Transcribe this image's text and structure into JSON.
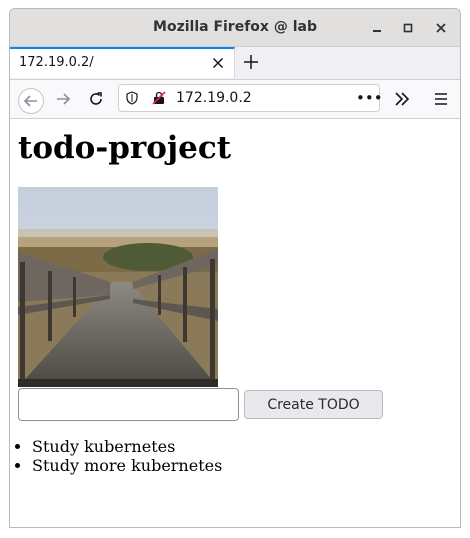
{
  "window": {
    "title": "Mozilla Firefox @ lab"
  },
  "tab": {
    "label": "172.19.0.2/"
  },
  "urlbar": {
    "url": "172.19.0.2",
    "more": "•••"
  },
  "page": {
    "title": "todo-project",
    "input": {
      "value": "",
      "placeholder": ""
    },
    "create_button": "Create TODO",
    "todos": [
      "Study kubernetes",
      "Study more kubernetes"
    ]
  },
  "icons": {
    "minimize": "minimize-icon",
    "maximize": "maximize-icon",
    "close": "close-icon",
    "back": "back-arrow-icon",
    "forward": "forward-arrow-icon",
    "reload": "reload-icon",
    "shield": "tracking-shield-icon",
    "insecure": "insecure-connection-icon",
    "overflow": "chevron-double-right-icon",
    "menu": "hamburger-menu-icon"
  },
  "colors": {
    "tab_accent": "#0a84ff",
    "titlebar": "#e1e0de"
  }
}
